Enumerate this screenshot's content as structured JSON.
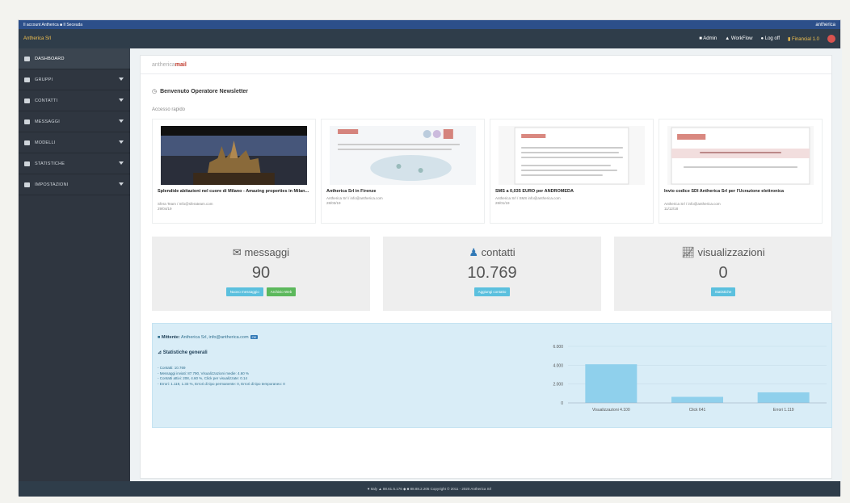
{
  "topbar": {
    "left_text": "Il account Antherica ■ Il Seceuda",
    "right_text": "antherica",
    "brand": "Antherica Srl",
    "tools": [
      {
        "label": "Admin",
        "icon": "user-icon"
      },
      {
        "label": "WorkFlow",
        "icon": "flow-icon"
      },
      {
        "label": "Log off",
        "icon": "power-icon"
      },
      {
        "label": "Financial 1.0",
        "icon": "warning-icon"
      }
    ]
  },
  "sidebar": {
    "items": [
      {
        "label": "DASHBOARD",
        "active": true
      },
      {
        "label": "GRUPPI",
        "active": false
      },
      {
        "label": "CONTATTI",
        "active": false
      },
      {
        "label": "MESSAGGI",
        "active": false
      },
      {
        "label": "MODELLI",
        "active": false
      },
      {
        "label": "STATISTICHE",
        "active": false
      },
      {
        "label": "IMPOSTAZIONI",
        "active": false
      }
    ]
  },
  "header": {
    "brand_prefix": "antherica",
    "brand_suffix": "mail",
    "welcome": "Benvenuto Operatore Newsletter",
    "quick_access": "Accesso rapido"
  },
  "cards": [
    {
      "title": "Splendide abitazioni nel cuore di Milano - Amazing properties in Milan...",
      "meta1": "Sfera Team / Info@sferateam.com",
      "meta2": "29/04/19"
    },
    {
      "title": "Antherica Srl in Firenze",
      "meta1": "Antherica Srl / info@antherica.com",
      "meta2": "28/03/19"
    },
    {
      "title": "SMS a 0,035 EURO per ANDROMEDA",
      "meta1": "Antherica Srl / SMS info@antherica.com",
      "meta2": "28/01/19"
    },
    {
      "title": "Invio codice SDI Antherica Srl per l'Ucrazione elettronica",
      "meta1": "Antherica Srl / info@antherica.com",
      "meta2": "11/12/18"
    }
  ],
  "stats": [
    {
      "label": "messaggi",
      "icon": "envelope-icon",
      "value": "90",
      "buttons": [
        {
          "label": "Nuovo messaggio",
          "color": "#5bc0de"
        },
        {
          "label": "Archivio Web",
          "color": "#5cb85c"
        }
      ]
    },
    {
      "label": "contatti",
      "icon": "users-icon",
      "value": "10.769",
      "buttons": [
        {
          "label": "Aggiungi contatto",
          "color": "#5bc0de"
        }
      ]
    },
    {
      "label": "visualizzazioni",
      "icon": "chart-line-icon",
      "value": "0",
      "buttons": [
        {
          "label": "Statistiche",
          "color": "#5bc0de"
        }
      ]
    }
  ],
  "panel": {
    "sender_label": "Mittente:",
    "sender_value": "Antherica Srl, info@antherica.com",
    "tag": "OK",
    "subtitle": "Statistiche generali",
    "lines": [
      "- Contatti: 10.769",
      "- Messaggi inviati: 87.790, Visualizzazioni medie: 4.60 %",
      "- Contatti attivi: 208, 4.60 %, Click per visualizzate: 0.14",
      "- Errori: 1.119, 1.33 %, Errori di tipo permanente: 0, Errori di tipo temporaneo: 0"
    ]
  },
  "chart_data": {
    "type": "bar",
    "categories": [
      "Visualizzazioni 4.100",
      "Click 641",
      "Errori 1.119"
    ],
    "values": [
      4100,
      641,
      1119
    ],
    "ylim": [
      0,
      6000
    ],
    "yticks": [
      "0",
      "2.000",
      "4.000",
      "6.000"
    ],
    "grid": true,
    "bar_color": "#8fd0ec"
  },
  "footer": {
    "text": "♥ Italy  ▲ 88.61.5.176  ◆  ■ 88.88.2.205  Copyright © 2011 - 2020 Antherica Srl"
  }
}
